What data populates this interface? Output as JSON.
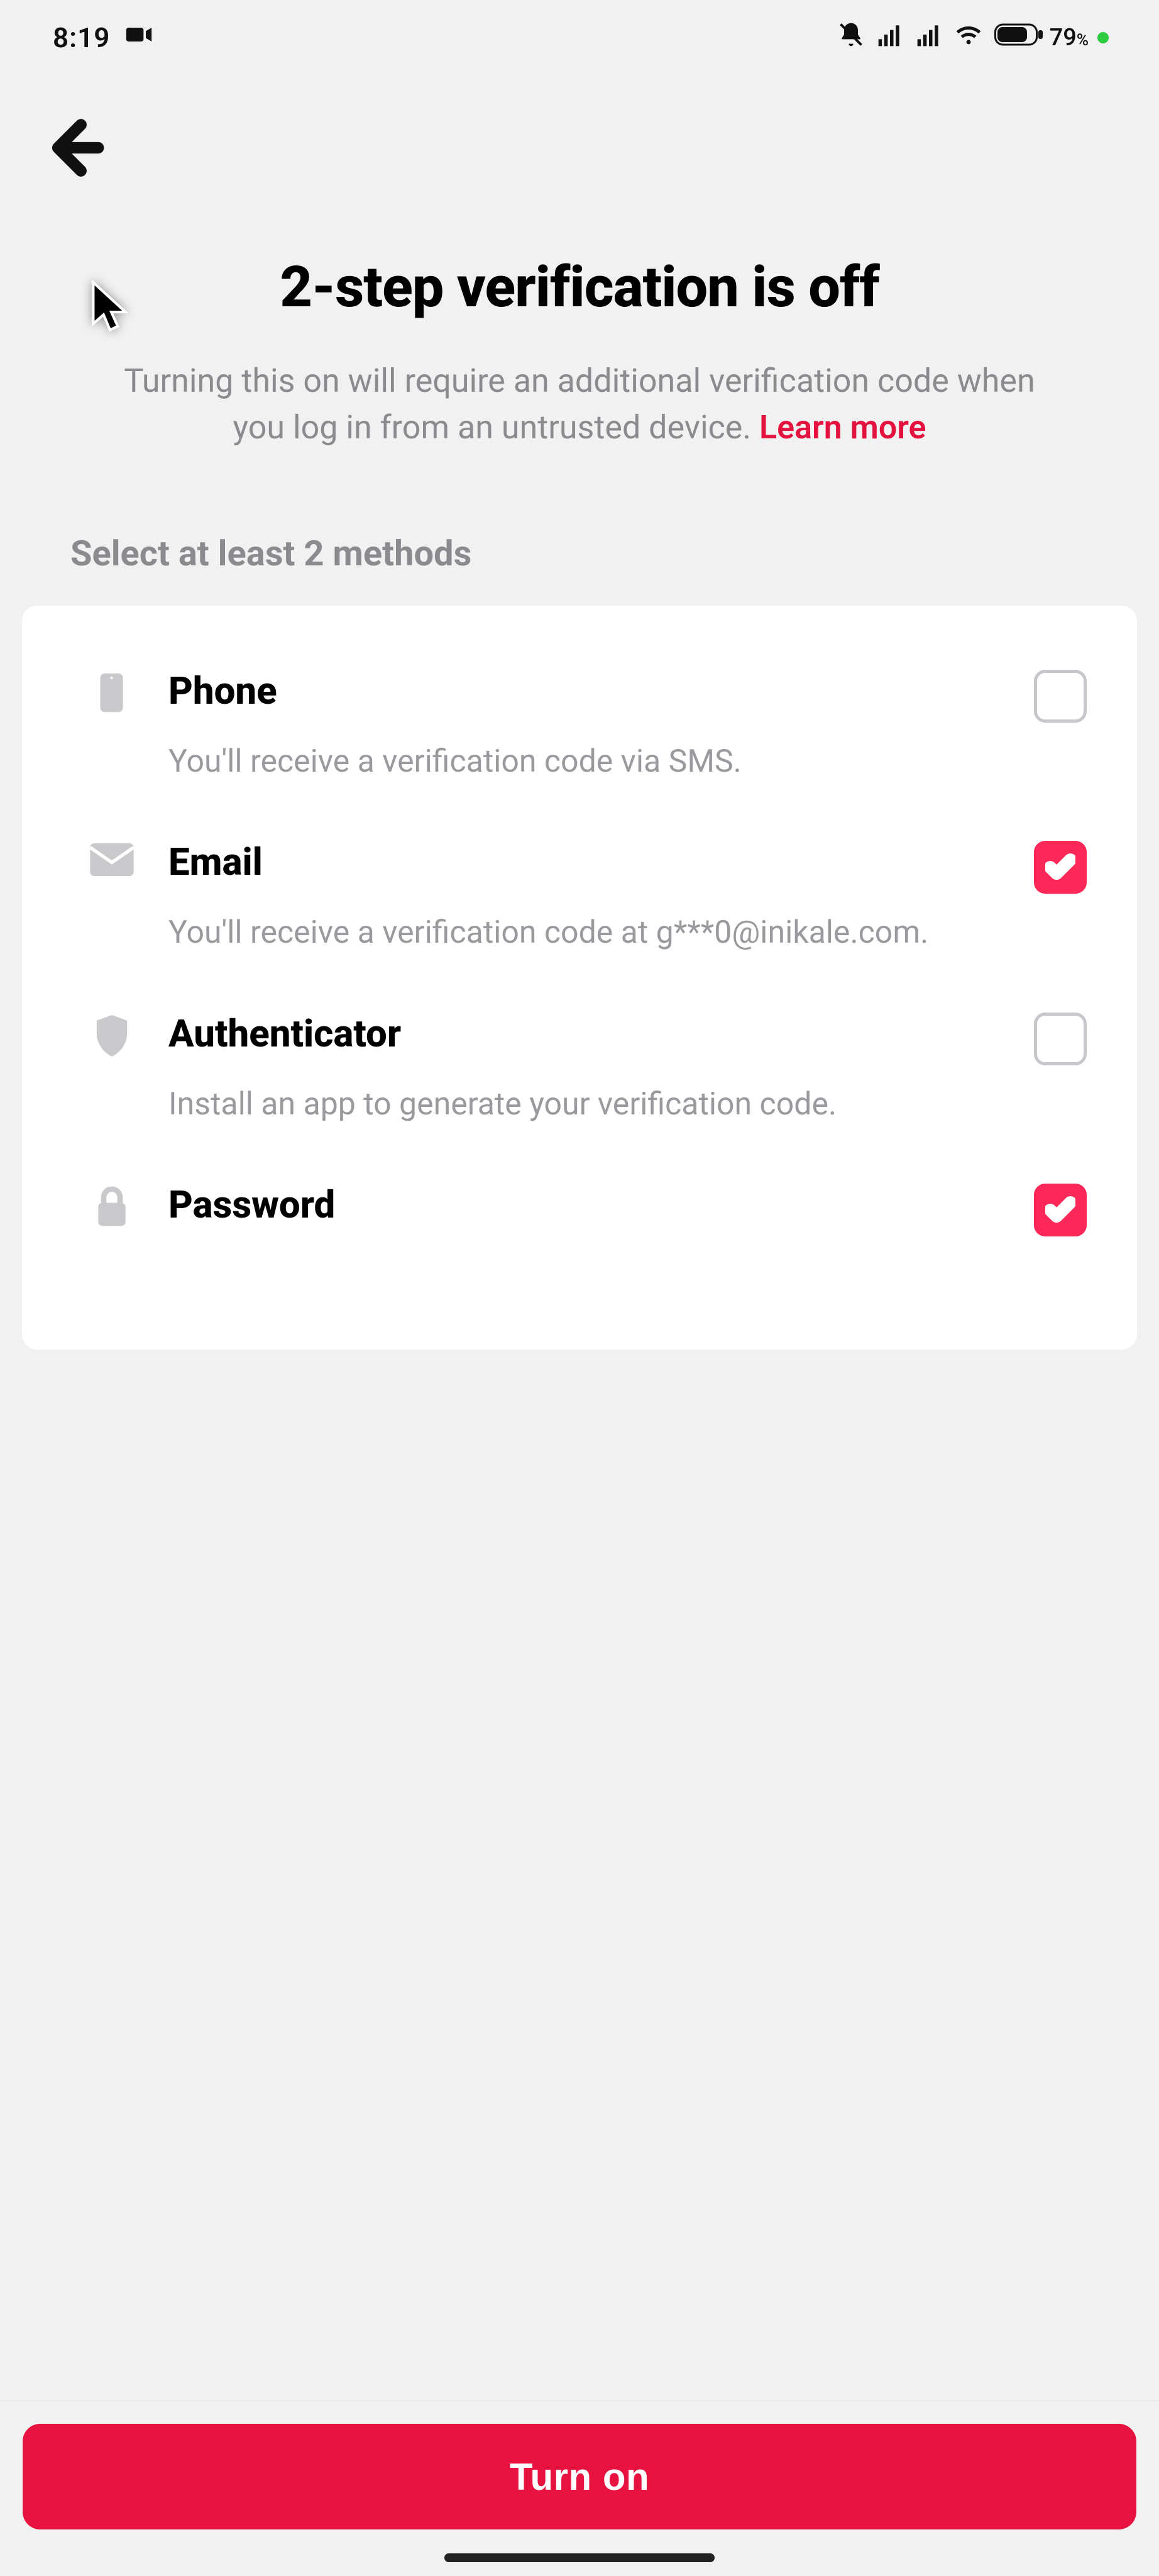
{
  "status": {
    "time": "8:19",
    "battery_percent": "79"
  },
  "header": {
    "title": "2-step verification is off",
    "subtitle": "Turning this on will require an additional verification code when you log in from an untrusted device. ",
    "learn_more": "Learn more"
  },
  "section_label": "Select at least 2 methods",
  "methods": {
    "phone": {
      "title": "Phone",
      "desc": "You'll receive a verification code via SMS.",
      "checked": false
    },
    "email": {
      "title": "Email",
      "desc": "You'll receive a verification code at g***0@inikale.com.",
      "checked": true
    },
    "authenticator": {
      "title": "Authenticator",
      "desc": "Install an app to generate your verification code.",
      "checked": false
    },
    "password": {
      "title": "Password",
      "checked": true
    }
  },
  "cta": "Turn on",
  "colors": {
    "accent": "#fe2858",
    "link": "#e4123f"
  }
}
